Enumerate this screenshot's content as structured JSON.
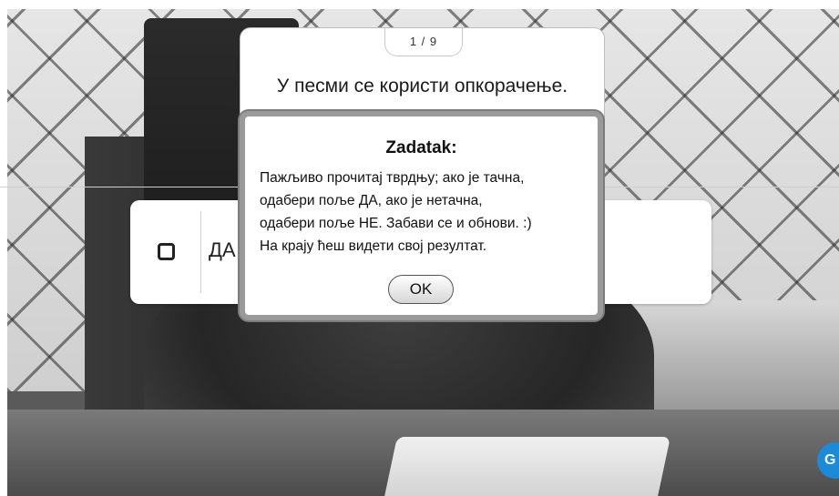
{
  "question": {
    "counter": "1 / 9",
    "text": "У песми се користи опкорачење."
  },
  "answer": {
    "option_label": "ДА"
  },
  "modal": {
    "title": "Zadatak:",
    "body_lines": [
      "Пажљиво прочитај тврдњу; ако је тачна,",
      "одабери поље ДА, ако је нетачна,",
      "одабери поље НЕ. Забави се и обнови. :)",
      "На крају ћеш видети свој резултат."
    ],
    "ok_label": "OK"
  },
  "badge": {
    "label": "G",
    "color": "#1b8ad8"
  }
}
